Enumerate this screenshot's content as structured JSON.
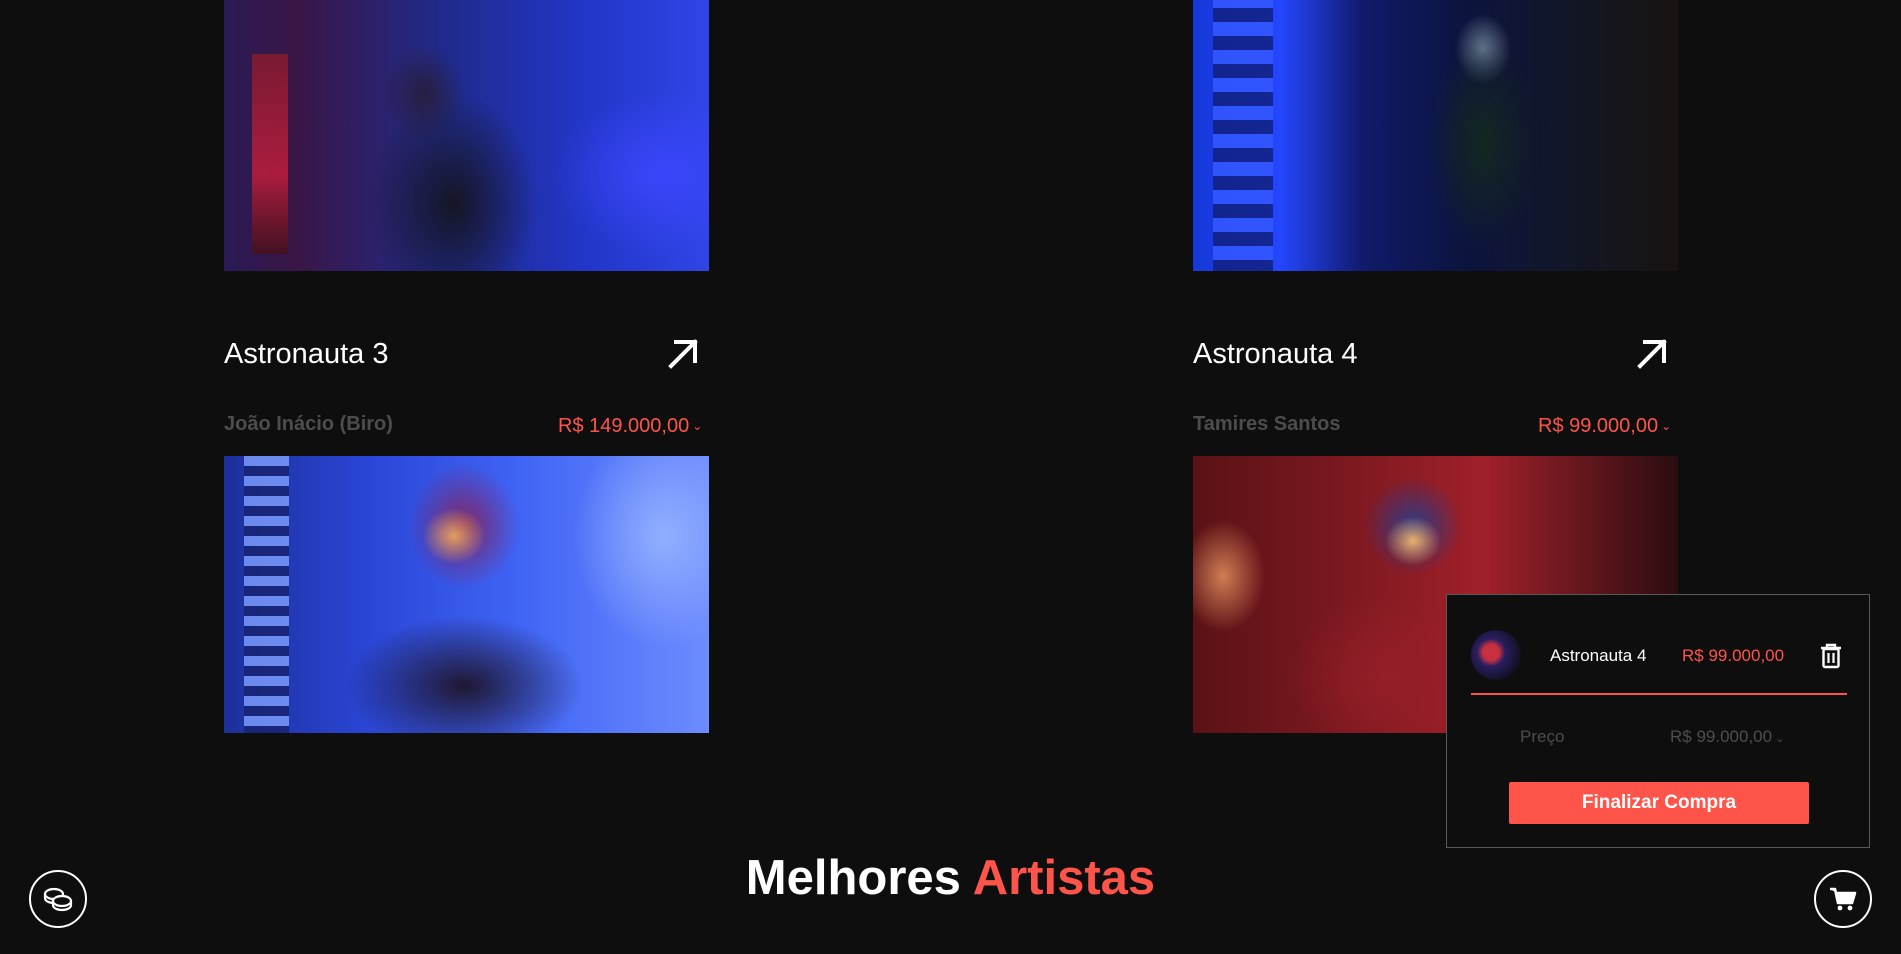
{
  "products": [
    {
      "title": "Astronauta 3",
      "artist": "João Inácio (Biro)",
      "price": "R$ 149.000,00"
    },
    {
      "title": "Astronauta 4",
      "artist": "Tamires Santos",
      "price": "R$ 99.000,00"
    }
  ],
  "cart": {
    "item": {
      "name": "Astronauta 4",
      "price": "R$ 99.000,00"
    },
    "summary": {
      "label": "Preço",
      "value": "R$ 99.000,00"
    },
    "checkout_label": "Finalizar Compra"
  },
  "section": {
    "title_part1": "Melhores",
    "title_part2": "Artistas"
  },
  "icons": {
    "arrow": "arrow-up-right-icon",
    "coins": "coins-icon",
    "cart": "shopping-cart-icon",
    "trash": "trash-icon",
    "chevron": "chevron-down-icon"
  },
  "colors": {
    "accent": "#ff5449",
    "background": "#0e0e0e",
    "muted": "#4d4d4d"
  }
}
